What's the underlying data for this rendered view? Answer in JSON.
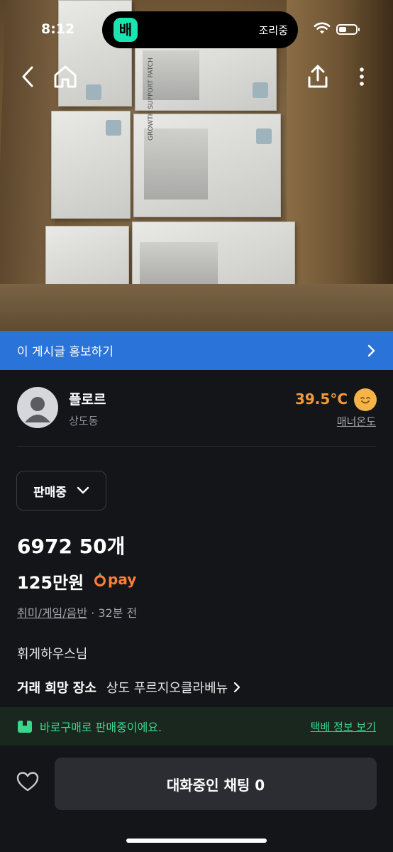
{
  "status_bar": {
    "time": "8:12",
    "island_app_text": "조리중",
    "island_logo": "배"
  },
  "nav": {
    "icons": [
      "back-arrow-icon",
      "home-icon",
      "share-icon",
      "more-vertical-icon"
    ]
  },
  "promo": {
    "label": "이 게시글 홍보하기"
  },
  "seller": {
    "name": "플로르",
    "location": "상도동",
    "temperature": "39.5°C",
    "temperature_label": "매너온도",
    "temperature_color": "#f39a3a"
  },
  "item": {
    "status": "판매중",
    "title": "6972 50개",
    "price": "125만원",
    "pay_label": "pay",
    "category": "취미/게임/음반",
    "time_ago": "· 32분 전",
    "description": "휘게하우스님",
    "place_label": "거래 희망 장소",
    "place_value": "상도 푸르지오클라베뉴"
  },
  "safe_pay": {
    "text": "바로구매로 판매중이에요.",
    "link": "택배 정보 보기",
    "color": "#3bd58d"
  },
  "actions": {
    "chat_button": "대화중인 채팅 0"
  },
  "photo": {
    "package_text": "GROWTH SUPPORT PATCH"
  },
  "colors": {
    "accent_blue": "#2a73d9",
    "background": "#141518",
    "pay_orange": "#ff7e36"
  }
}
